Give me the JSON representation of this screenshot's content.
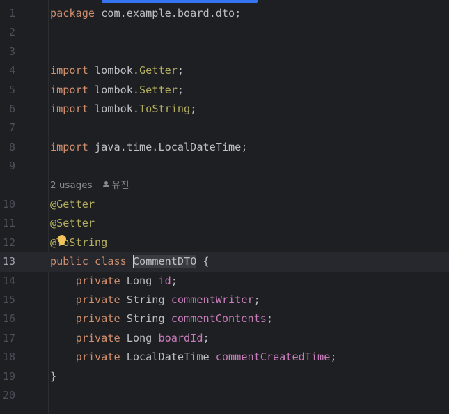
{
  "editor": {
    "lines": [
      {
        "n": "1",
        "tokens": [
          {
            "t": "package",
            "c": "kw"
          },
          {
            "t": " com.example.board.dto;",
            "c": ""
          }
        ]
      },
      {
        "n": "2",
        "tokens": []
      },
      {
        "n": "3",
        "tokens": []
      },
      {
        "n": "4",
        "tokens": [
          {
            "t": "import",
            "c": "kw"
          },
          {
            "t": " lombok.",
            "c": ""
          },
          {
            "t": "Getter",
            "c": "ann"
          },
          {
            "t": ";",
            "c": ""
          }
        ]
      },
      {
        "n": "5",
        "tokens": [
          {
            "t": "import",
            "c": "kw"
          },
          {
            "t": " lombok.",
            "c": ""
          },
          {
            "t": "Setter",
            "c": "ann"
          },
          {
            "t": ";",
            "c": ""
          }
        ]
      },
      {
        "n": "6",
        "tokens": [
          {
            "t": "import",
            "c": "kw"
          },
          {
            "t": " lombok.",
            "c": ""
          },
          {
            "t": "ToString",
            "c": "ann"
          },
          {
            "t": ";",
            "c": ""
          }
        ]
      },
      {
        "n": "7",
        "tokens": []
      },
      {
        "n": "8",
        "tokens": [
          {
            "t": "import",
            "c": "kw"
          },
          {
            "t": " java.time.LocalDateTime;",
            "c": ""
          }
        ]
      },
      {
        "n": "9",
        "tokens": []
      },
      {
        "n": "",
        "hint": {
          "usages": "2 usages",
          "author": "유진"
        }
      },
      {
        "n": "10",
        "tokens": [
          {
            "t": "@Getter",
            "c": "ann"
          }
        ]
      },
      {
        "n": "11",
        "tokens": [
          {
            "t": "@Setter",
            "c": "ann"
          }
        ]
      },
      {
        "n": "12",
        "tokens": [
          {
            "t": "@ToString",
            "c": "ann"
          }
        ]
      },
      {
        "n": "13",
        "current": true,
        "tokens": [
          {
            "t": "public",
            "c": "kw"
          },
          {
            "t": " ",
            "c": ""
          },
          {
            "t": "class",
            "c": "kw"
          },
          {
            "t": " ",
            "c": ""
          },
          {
            "caret": true
          },
          {
            "t": "CommentDTO",
            "c": "cls-hl"
          },
          {
            "t": " {",
            "c": ""
          }
        ]
      },
      {
        "n": "14",
        "tokens": [
          {
            "t": "    ",
            "c": ""
          },
          {
            "t": "private",
            "c": "kw"
          },
          {
            "t": " Long ",
            "c": ""
          },
          {
            "t": "id",
            "c": "fld"
          },
          {
            "t": ";",
            "c": ""
          }
        ]
      },
      {
        "n": "15",
        "tokens": [
          {
            "t": "    ",
            "c": ""
          },
          {
            "t": "private",
            "c": "kw"
          },
          {
            "t": " String ",
            "c": ""
          },
          {
            "t": "commentWriter",
            "c": "fld"
          },
          {
            "t": ";",
            "c": ""
          }
        ]
      },
      {
        "n": "16",
        "tokens": [
          {
            "t": "    ",
            "c": ""
          },
          {
            "t": "private",
            "c": "kw"
          },
          {
            "t": " String ",
            "c": ""
          },
          {
            "t": "commentContents",
            "c": "fld"
          },
          {
            "t": ";",
            "c": ""
          }
        ]
      },
      {
        "n": "17",
        "tokens": [
          {
            "t": "    ",
            "c": ""
          },
          {
            "t": "private",
            "c": "kw"
          },
          {
            "t": " Long ",
            "c": ""
          },
          {
            "t": "boardId",
            "c": "fld"
          },
          {
            "t": ";",
            "c": ""
          }
        ]
      },
      {
        "n": "18",
        "tokens": [
          {
            "t": "    ",
            "c": ""
          },
          {
            "t": "private",
            "c": "kw"
          },
          {
            "t": " LocalDateTime ",
            "c": ""
          },
          {
            "t": "commentCreatedTime",
            "c": "fld"
          },
          {
            "t": ";",
            "c": ""
          }
        ]
      },
      {
        "n": "19",
        "tokens": [
          {
            "t": "}",
            "c": ""
          }
        ]
      },
      {
        "n": "20",
        "tokens": []
      }
    ],
    "icons": {
      "intention_bulb": "lightbulb-icon",
      "author": "user-icon"
    },
    "colors": {
      "background": "#1e1f22",
      "keyword": "#cf8e6d",
      "annotation": "#b3ae60",
      "field": "#c77dbb",
      "text": "#bcbec4",
      "line_number": "#4b5059",
      "scroll_accent": "#3574f0",
      "bulb": "#f2c55c"
    }
  }
}
